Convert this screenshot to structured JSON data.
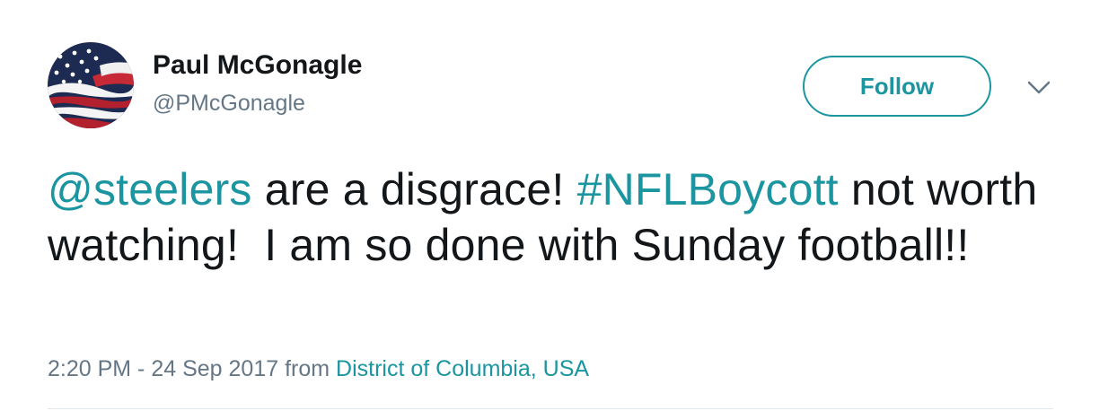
{
  "user": {
    "display_name": "Paul McGonagle",
    "handle": "@PMcGonagle"
  },
  "actions": {
    "follow_label": "Follow"
  },
  "tweet": {
    "mention": "@steelers",
    "text_1": " are a disgrace! ",
    "hashtag": "#NFLBoycott",
    "text_2": " not worth watching!  I am so done with Sunday football!!"
  },
  "meta": {
    "time": "2:20 PM",
    "separator": " - ",
    "date": "24 Sep 2017",
    "from_label": " from ",
    "location": "District of Columbia, USA"
  },
  "colors": {
    "accent": "#1b95a0",
    "text": "#14171a",
    "muted": "#657786"
  }
}
